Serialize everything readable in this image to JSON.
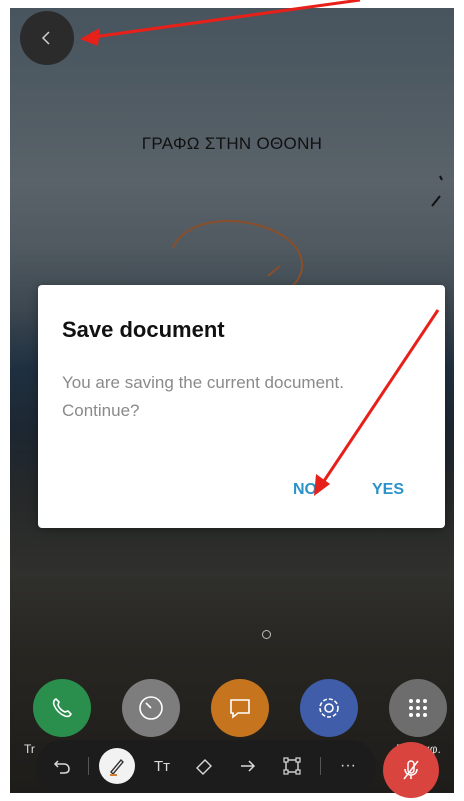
{
  "screen": {
    "note_text": "ΓΡΑΦΩ ΣΤΗΝ ΟΘΟΝΗ"
  },
  "back_button": {
    "icon": "chevron-left-icon"
  },
  "dialog": {
    "title": "Save document",
    "message": "You are saving the current document. Continue?",
    "no_label": "NO",
    "yes_label": "YES",
    "accent_color": "#2a93c9"
  },
  "dock": {
    "apps": [
      {
        "icon": "phone-icon",
        "color": "#2a8e4c"
      },
      {
        "icon": "clock-icon",
        "color": "#7d7d7d"
      },
      {
        "icon": "message-icon",
        "color": "#c7741e"
      },
      {
        "icon": "settings-icon",
        "color": "#3f5da8"
      },
      {
        "icon": "apps-grid-icon",
        "color": "#6d6d6d"
      }
    ],
    "label_left": "Tr",
    "label_right": "Εγγραφ."
  },
  "toolbar": {
    "tools": [
      "undo-icon",
      "pen-icon",
      "text-icon",
      "eraser-icon",
      "arrow-icon",
      "crop-icon",
      "more-icon"
    ],
    "text_tool_label": "Tт",
    "more_label": "···",
    "mic_icon": "mic-off-icon"
  },
  "annotations": {
    "arrow_color": "#e8201a"
  }
}
